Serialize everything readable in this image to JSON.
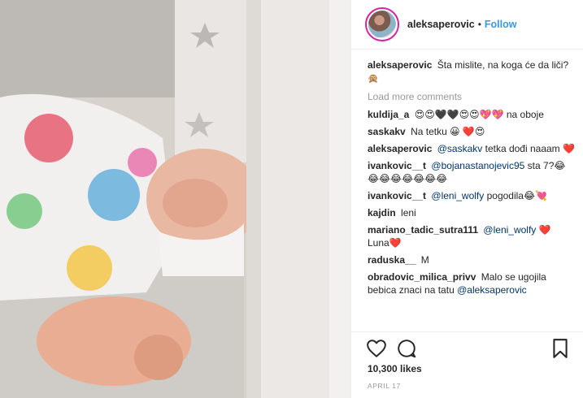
{
  "post": {
    "username": "aleksaperovic",
    "separator": "•",
    "follow_label": "Follow",
    "caption": {
      "user": "aleksaperovic",
      "text": "Šta mislite, na koga će da liči?",
      "emoji": "🙊"
    },
    "load_more_label": "Load more comments",
    "comments": [
      {
        "user": "kuldija_a",
        "mention": "",
        "text": "😍😍🖤🖤😍😍💖💖 na oboje"
      },
      {
        "user": "saskakv",
        "mention": "",
        "text": "Na tetku 😀 ❤️😍"
      },
      {
        "user": "aleksaperovic",
        "mention": "@saskakv",
        "text": "tetka dođi naaam ❤️"
      },
      {
        "user": "ivankovic__t",
        "mention": "@bojanastanojevic95",
        "text": "sta 7?😂😂😂😂😂😂😂😂"
      },
      {
        "user": "ivankovic__t",
        "mention": "@leni_wolfy",
        "text": "pogodila😂💘"
      },
      {
        "user": "kajdin",
        "mention": "",
        "text": "leni"
      },
      {
        "user": "mariano_tadic_sutra111",
        "mention": "@leni_wolfy",
        "text": "❤️ Luna❤️"
      },
      {
        "user": "raduska__",
        "mention": "",
        "text": "M"
      },
      {
        "user": "obradovic_milica_privv",
        "mention": "",
        "text": "Malo se ugojila bebica znaci na tatu",
        "mention_after": "@aleksaperovic"
      }
    ],
    "likes": "10,300 likes",
    "date": "APRIL 17",
    "icons": {
      "like": "heart-icon",
      "comment": "comment-icon",
      "save": "bookmark-icon"
    },
    "colors": {
      "link": "#3897f0",
      "mention": "#003569",
      "muted": "#999999",
      "border": "#efefef"
    }
  }
}
